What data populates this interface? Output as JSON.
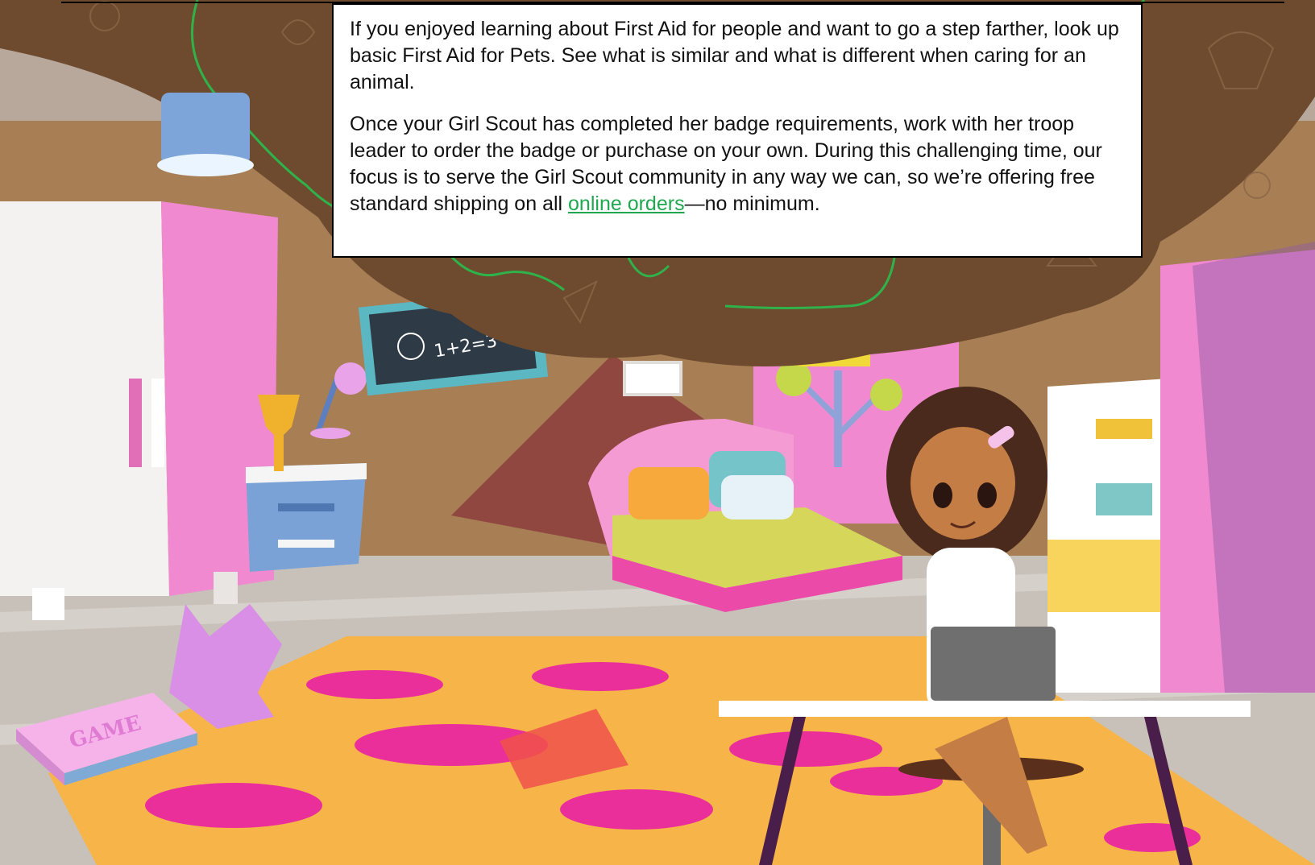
{
  "panel": {
    "paragraph1": "If you enjoyed learning about First Aid for people and want to go a step farther, look up basic First Aid for Pets. See what is similar and what is different when caring for an animal.",
    "paragraph2_before": "Once your Girl Scout has completed her badge requirements, work with her troop leader to order the badge or purchase on your own. During this challenging time, our focus is to serve the Girl Scout community in any way we can, so we’re offering free standard shipping on all ",
    "link_text": "online orders",
    "paragraph2_after": "—no minimum."
  },
  "illustration": {
    "chalkboard_text": "1+2=3",
    "game_box_text": "GAME"
  },
  "colors": {
    "wall_brown": "#a77c52",
    "ceiling_brown": "#6d4b2f",
    "pink": "#f07fca",
    "magenta": "#ea3ca0",
    "rug_orange": "#f6b043",
    "floor": "#c9c2bc",
    "green_line": "#2fb24a",
    "link_green": "#1fa84f"
  }
}
